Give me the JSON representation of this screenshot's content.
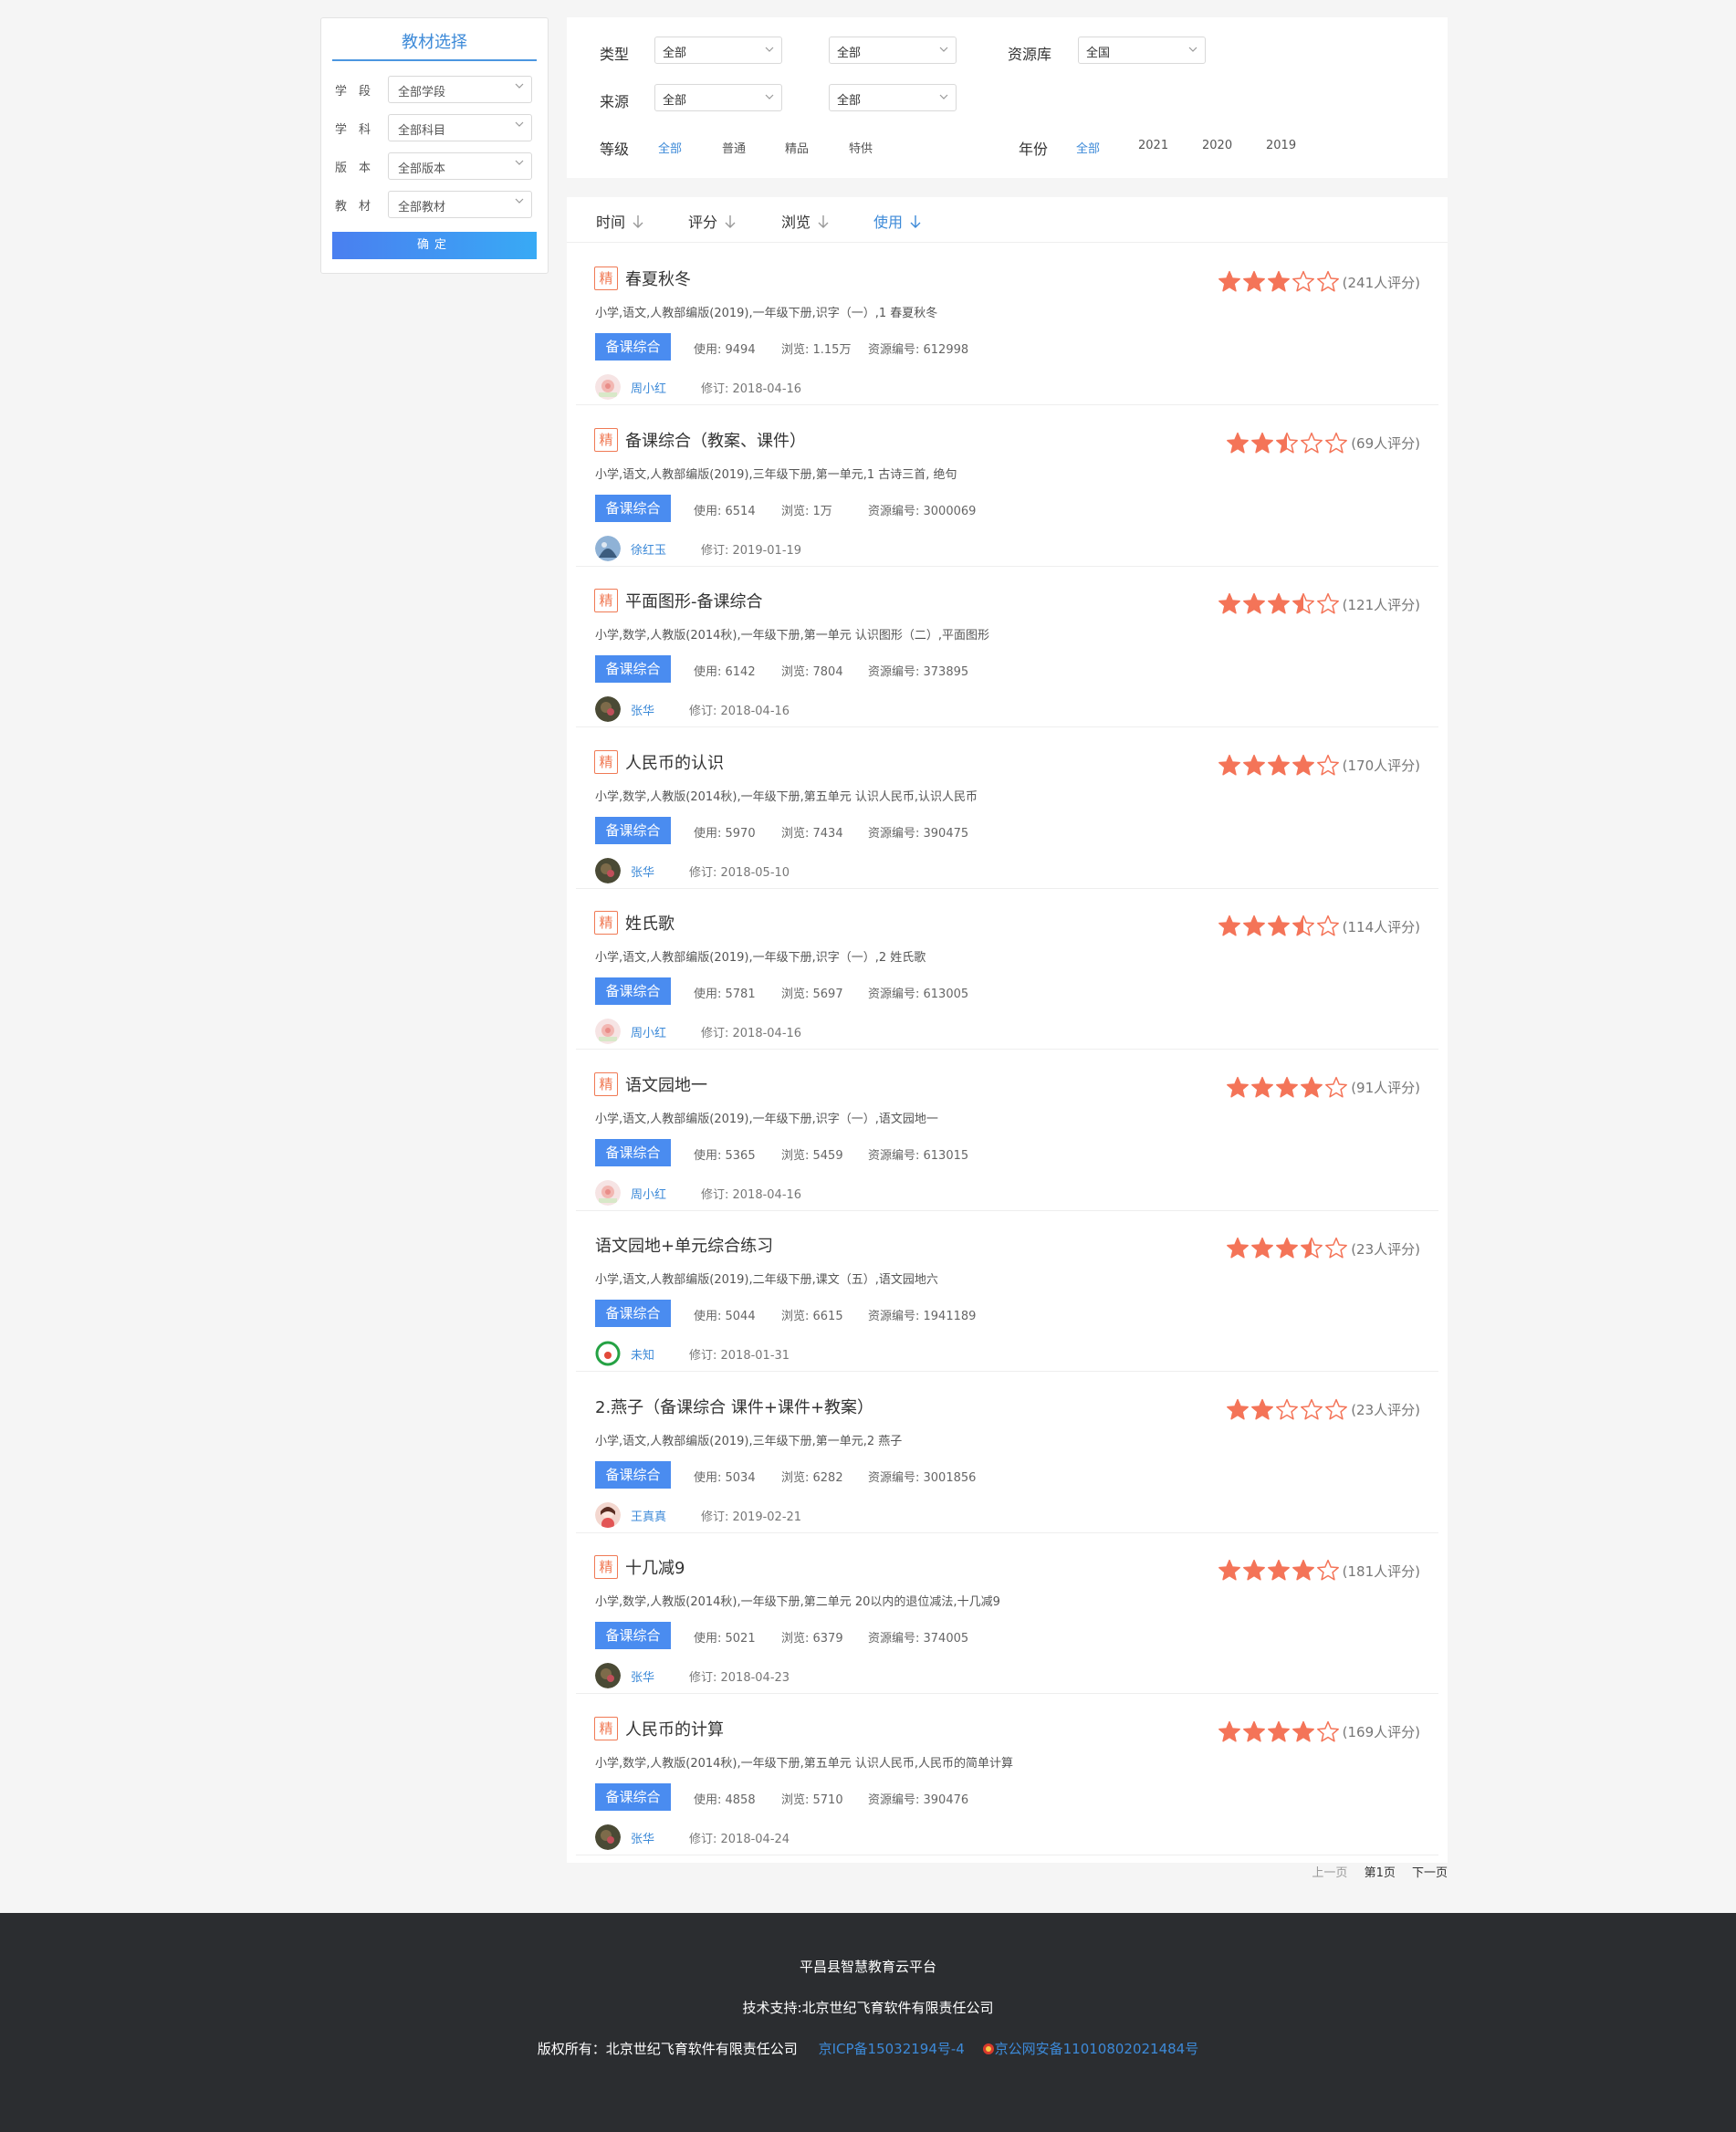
{
  "sidebar": {
    "title": "教材选择",
    "rows": [
      {
        "label": "学段",
        "value": "全部学段"
      },
      {
        "label": "学科",
        "value": "全部科目"
      },
      {
        "label": "版本",
        "value": "全部版本"
      },
      {
        "label": "教材",
        "value": "全部教材"
      }
    ],
    "confirm": "确定"
  },
  "filters": {
    "type_label": "类型",
    "type_value": "全部",
    "type_value2": "全部",
    "repo_label": "资源库",
    "repo_value": "全国",
    "source_label": "来源",
    "source_value": "全部",
    "source_value2": "全部",
    "level_label": "等级",
    "levels": [
      "全部",
      "普通",
      "精品",
      "特供"
    ],
    "year_label": "年份",
    "years": [
      "全部",
      "2021",
      "2020",
      "2019"
    ]
  },
  "sort": {
    "items": [
      "时间",
      "评分",
      "浏览",
      "使用"
    ],
    "active": "使用"
  },
  "colors": {
    "accent": "#3d8ad8",
    "star": "#f47458",
    "tag": "#4a8cf0",
    "badge": "#f07a55",
    "footer_bg": "#2b2d30"
  },
  "resources": [
    {
      "featured": true,
      "title": "春夏秋冬",
      "path": "小学,语文,人教部编版(2019),一年级下册,识字（一）,1 春夏秋冬",
      "tag": "备课综合",
      "use": "使用: 9494",
      "view": "浏览: 1.15万",
      "id": "资源编号: 612998",
      "author": "周小红",
      "revised": "修订: 2018-04-16",
      "rating": 3,
      "rating_count": "(241人评分)",
      "avatar": "flower"
    },
    {
      "featured": true,
      "title": "备课综合（教案、课件）",
      "path": "小学,语文,人教部编版(2019),三年级下册,第一单元,1 古诗三首, 绝句",
      "tag": "备课综合",
      "use": "使用: 6514",
      "view": "浏览: 1万",
      "id": "资源编号: 3000069",
      "author": "徐红玉",
      "revised": "修订: 2019-01-19",
      "rating": 2.5,
      "rating_count": "(69人评分)",
      "avatar": "blue"
    },
    {
      "featured": true,
      "title": "平面图形-备课综合",
      "path": "小学,数学,人教版(2014秋),一年级下册,第一单元 认识图形（二）,平面图形",
      "tag": "备课综合",
      "use": "使用: 6142",
      "view": "浏览: 7804",
      "id": "资源编号: 373895",
      "author": "张华",
      "revised": "修订: 2018-04-16",
      "rating": 3.5,
      "rating_count": "(121人评分)",
      "avatar": "dark"
    },
    {
      "featured": true,
      "title": "人民币的认识",
      "path": "小学,数学,人教版(2014秋),一年级下册,第五单元 认识人民币,认识人民币",
      "tag": "备课综合",
      "use": "使用: 5970",
      "view": "浏览: 7434",
      "id": "资源编号: 390475",
      "author": "张华",
      "revised": "修订: 2018-05-10",
      "rating": 4,
      "rating_count": "(170人评分)",
      "avatar": "dark"
    },
    {
      "featured": true,
      "title": "姓氏歌",
      "path": "小学,语文,人教部编版(2019),一年级下册,识字（一）,2 姓氏歌",
      "tag": "备课综合",
      "use": "使用: 5781",
      "view": "浏览: 5697",
      "id": "资源编号: 613005",
      "author": "周小红",
      "revised": "修订: 2018-04-16",
      "rating": 3.5,
      "rating_count": "(114人评分)",
      "avatar": "flower"
    },
    {
      "featured": true,
      "title": "语文园地一",
      "path": "小学,语文,人教部编版(2019),一年级下册,识字（一）,语文园地一",
      "tag": "备课综合",
      "use": "使用: 5365",
      "view": "浏览: 5459",
      "id": "资源编号: 613015",
      "author": "周小红",
      "revised": "修订: 2018-04-16",
      "rating": 4,
      "rating_count": "(91人评分)",
      "avatar": "flower"
    },
    {
      "featured": false,
      "title": "语文园地+单元综合练习",
      "path": "小学,语文,人教部编版(2019),二年级下册,课文（五）,语文园地六",
      "tag": "备课综合",
      "use": "使用: 5044",
      "view": "浏览: 6615",
      "id": "资源编号: 1941189",
      "author": "未知",
      "revised": "修订: 2018-01-31",
      "rating": 3.5,
      "rating_count": "(23人评分)",
      "avatar": "green"
    },
    {
      "featured": false,
      "title": "2.燕子（备课综合 课件+课件+教案）",
      "path": "小学,语文,人教部编版(2019),三年级下册,第一单元,2 燕子",
      "tag": "备课综合",
      "use": "使用: 5034",
      "view": "浏览: 6282",
      "id": "资源编号: 3001856",
      "author": "王真真",
      "revised": "修订: 2019-02-21",
      "rating": 2,
      "rating_count": "(23人评分)",
      "avatar": "girl"
    },
    {
      "featured": true,
      "title": "十几减9",
      "path": "小学,数学,人教版(2014秋),一年级下册,第二单元 20以内的退位减法,十几减9",
      "tag": "备课综合",
      "use": "使用: 5021",
      "view": "浏览: 6379",
      "id": "资源编号: 374005",
      "author": "张华",
      "revised": "修订: 2018-04-23",
      "rating": 4,
      "rating_count": "(181人评分)",
      "avatar": "dark"
    },
    {
      "featured": true,
      "title": "人民币的计算",
      "path": "小学,数学,人教版(2014秋),一年级下册,第五单元 认识人民币,人民币的简单计算",
      "tag": "备课综合",
      "use": "使用: 4858",
      "view": "浏览: 5710",
      "id": "资源编号: 390476",
      "author": "张华",
      "revised": "修订: 2018-04-24",
      "rating": 4,
      "rating_count": "(169人评分)",
      "avatar": "dark"
    }
  ],
  "featured_badge": "精",
  "pager": {
    "prev": "上一页",
    "current": "第1页",
    "next": "下一页"
  },
  "footer": {
    "platform": "平昌县智慧教育云平台",
    "support": "技术支持:北京世纪飞育软件有限责任公司",
    "copyright": "版权所有：北京世纪飞育软件有限责任公司",
    "icp": "京ICP备15032194号-4",
    "police": "京公网安备11010802021484号"
  }
}
